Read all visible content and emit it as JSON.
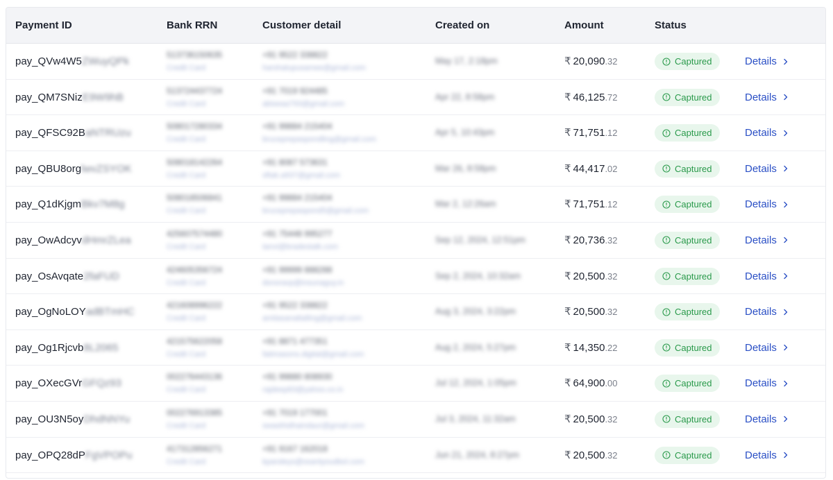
{
  "columns": {
    "payment_id": "Payment ID",
    "bank_rrn": "Bank RRN",
    "customer_detail": "Customer detail",
    "created_on": "Created on",
    "amount": "Amount",
    "status": "Status"
  },
  "colors": {
    "accent_link": "#2a4fc5",
    "status_bg": "#e8f6ec",
    "status_text": "#2a9a4b",
    "header_bg": "#f3f4f7"
  },
  "rows": [
    {
      "pid": "pay_QVw4W5",
      "pid_blur": "ZWuyQPk",
      "rrn": "513736150635",
      "rrn_sub": "Credit Card",
      "phone": "+91 9522 338822",
      "email": "harshalupusamee@gmail.com",
      "created": "May 17, 2:18pm",
      "amount_int": "20,090",
      "amount_dec": ".32",
      "status": "Captured",
      "details": "Details"
    },
    {
      "pid": "pay_QM7SNiz",
      "pid_blur": "E9W9hB",
      "rrn": "513724437724",
      "rrn_sub": "Credit Card",
      "phone": "+91 7019 924485",
      "email": "abiseaa793@gmail.com",
      "created": "Apr 22, 8:58pm",
      "amount_int": "46,125",
      "amount_dec": ".72",
      "status": "Captured",
      "details": "Details"
    },
    {
      "pid": "pay_QFSC92B",
      "pid_blur": "aNTRUzu",
      "rrn": "508017280334",
      "rrn_sub": "Credit Card",
      "phone": "+91 99884 215404",
      "email": "bruceprepaspondling@gmail.com",
      "created": "Apr 5, 10:43pm",
      "amount_int": "71,751",
      "amount_dec": ".12",
      "status": "Captured",
      "details": "Details"
    },
    {
      "pid": "pay_QBU8org",
      "pid_blur": "lwvZSYOK",
      "rrn": "508018142264",
      "rrn_sub": "Credit Card",
      "phone": "+91 8087 573631",
      "email": "sftak.a937@gmail.com",
      "created": "Mar 26, 8:58pm",
      "amount_int": "44,417",
      "amount_dec": ".02",
      "status": "Captured",
      "details": "Details"
    },
    {
      "pid": "pay_Q1dKjgm",
      "pid_blur": "Bkv7M8g",
      "rrn": "508018506841",
      "rrn_sub": "Credit Card",
      "phone": "+91 99884 215404",
      "email": "bruceprepaspond5@gmail.com",
      "created": "Mar 2, 12:26am",
      "amount_int": "71,751",
      "amount_dec": ".12",
      "status": "Captured",
      "details": "Details"
    },
    {
      "pid": "pay_OwAdcyv",
      "pid_blur": "dHmrZLea",
      "rrn": "425607574480",
      "rrn_sub": "Credit Card",
      "phone": "+91 75448 995277",
      "email": "tanvi@bradestalk.com",
      "created": "Sep 12, 2024, 12:51pm",
      "amount_int": "20,736",
      "amount_dec": ".32",
      "status": "Captured",
      "details": "Details"
    },
    {
      "pid": "pay_OsAvqate",
      "pid_blur": "2faFUD",
      "rrn": "424605356724",
      "rrn_sub": "Credit Card",
      "phone": "+91 99999 888288",
      "email": "dsnoravp@insunaguy.in",
      "created": "Sep 2, 2024, 10:32am",
      "amount_int": "20,500",
      "amount_dec": ".32",
      "status": "Captured",
      "details": "Details"
    },
    {
      "pid": "pay_OgNoLOY",
      "pid_blur": "adBTmHC",
      "rrn": "421608996222",
      "rrn_sub": "Credit Card",
      "phone": "+91 9522 338822",
      "email": "amitasanaltalling@gmail.com",
      "created": "Aug 3, 2024, 3:22pm",
      "amount_int": "20,500",
      "amount_dec": ".32",
      "status": "Captured",
      "details": "Details"
    },
    {
      "pid": "pay_Og1Rjcvb",
      "pid_blur": "8L2065",
      "rrn": "421575622058",
      "rrn_sub": "Credit Card",
      "phone": "+91 8871 477351",
      "email": "fatimasons.digital@gmail.com",
      "created": "Aug 2, 2024, 5:27pm",
      "amount_int": "14,350",
      "amount_dec": ".22",
      "status": "Captured",
      "details": "Details"
    },
    {
      "pid": "pay_OXecGVr",
      "pid_blur": "GFQz93",
      "rrn": "002276443136",
      "rrn_sub": "Credit Card",
      "phone": "+91 99880 808930",
      "email": "rajdeep83@yahoo.co.in",
      "created": "Jul 12, 2024, 1:05pm",
      "amount_int": "64,900",
      "amount_dec": ".00",
      "status": "Captured",
      "details": "Details"
    },
    {
      "pid": "pay_OU3N5oy",
      "pid_blur": "DhdNNYu",
      "rrn": "002276913385",
      "rrn_sub": "Credit Card",
      "phone": "+91 7019 177001",
      "email": "swasthidhaindaur@gmail.com",
      "created": "Jul 3, 2024, 11:32am",
      "amount_int": "20,500",
      "amount_dec": ".32",
      "status": "Captured",
      "details": "Details"
    },
    {
      "pid": "pay_OPQ28dP",
      "pid_blur": "FgVPOPu",
      "rrn": "417312856271",
      "rrn_sub": "Credit Card",
      "phone": "+91 9167 162018",
      "email": "kpandeys@ssantyoudbol.com",
      "created": "Jun 21, 2024, 8:27pm",
      "amount_int": "20,500",
      "amount_dec": ".32",
      "status": "Captured",
      "details": "Details"
    }
  ]
}
